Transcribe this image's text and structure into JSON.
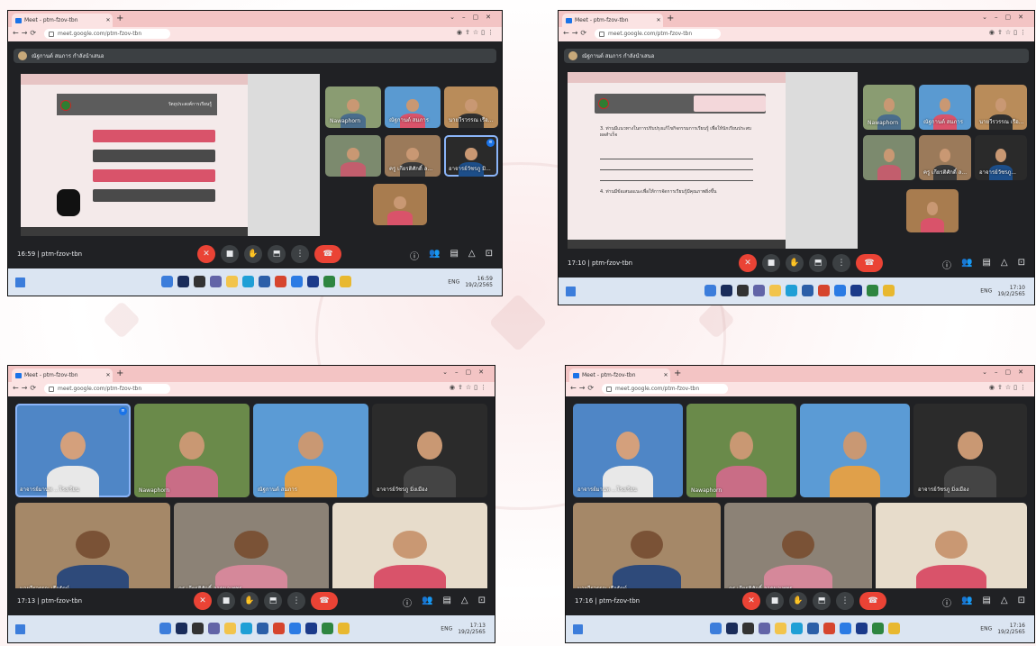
{
  "screenshots": [
    {
      "browser": {
        "tab_title": "Meet - ptm-fzov-tbn",
        "address": "meet.google.com/ptm-fzov-tbn"
      },
      "meeting": {
        "time": "16:59",
        "code": "ptm-fzov-tbn",
        "separator": "|"
      },
      "banner": "ณัฐกานต์ สมภาร กำลังนำเสนอ",
      "presentation": {
        "title": "วัตถุประสงค์การเรียนรู้"
      },
      "participants": [
        "Nawaphorn",
        "ณัฐกานต์ สมภาร",
        "นายวีรวรรณ เรือ...",
        "",
        "ครู เกียรติศักดิ์ ล...",
        "อาจารย์วัชรภู มิ..."
      ],
      "taskbar": {
        "time": "16:59",
        "date": "19/2/2565",
        "lang": "ENG"
      }
    },
    {
      "browser": {
        "tab_title": "Meet - ptm-fzov-tbn",
        "address": "meet.google.com/ptm-fzov-tbn"
      },
      "meeting": {
        "time": "17:10",
        "code": "ptm-fzov-tbn",
        "separator": "|"
      },
      "banner": "ณัฐกานต์ สมภาร กำลังนำเสนอ",
      "presentation": {
        "text1": "3. ท่านมีแนวทางในการปรับปรุงแก้ไขกิจกรรมการเรียนรู้ เพื่อให้นักเรียนประสบผลสำเร็จ",
        "text2": "4. ท่านมีข้อเสนอแนะเพื่อให้การจัดการเรียนรู้มีคุณภาพยิ่งขึ้น"
      },
      "participants": [
        "Nawaphorn",
        "ณัฐกานต์ สมภาร",
        "นายวีรวรรณ เรือ...",
        "",
        "ครู เกียรติศักดิ์ ล...",
        "อาจารย์วัชรภู..."
      ],
      "taskbar": {
        "time": "17:10",
        "date": "19/2/2565",
        "lang": "ENG"
      }
    },
    {
      "browser": {
        "tab_title": "Meet - ptm-fzov-tbn",
        "address": "meet.google.com/ptm-fzov-tbn"
      },
      "meeting": {
        "time": "17:13",
        "code": "ptm-fzov-tbn",
        "separator": "|"
      },
      "participants": [
        "อาจารย์มานพ ...โรงเรียน",
        "Nawaphorn",
        "ณัฐกานต์ สมภาร",
        "อาจารย์วัชรภู มิ่งเมือง",
        "นายวีรวรรณ เรือรัตน์",
        "ครู เกียรติศักดิ์ ลาดนาเพชร",
        ""
      ],
      "taskbar": {
        "time": "17:13",
        "date": "19/2/2565",
        "lang": "ENG"
      }
    },
    {
      "browser": {
        "tab_title": "Meet - ptm-fzov-tbn",
        "address": "meet.google.com/ptm-fzov-tbn"
      },
      "meeting": {
        "time": "17:16",
        "code": "ptm-fzov-tbn",
        "separator": "|"
      },
      "participants": [
        "อาจารย์มานพ ...โรงเรียน",
        "Nawaphorn",
        "",
        "อาจารย์วัชรภู มิ่งเมือง",
        "นายวีรวรรณ เรือรัตน์",
        "ครู เกียรติศักดิ์ ลาดนาเพชร",
        ""
      ],
      "taskbar": {
        "time": "17:16",
        "date": "19/2/2565",
        "lang": "ENG"
      }
    }
  ],
  "icons": {
    "controls": [
      "mic-off-icon",
      "camera-icon",
      "hand-icon",
      "present-icon",
      "more-icon",
      "hangup-icon"
    ],
    "right": [
      "info-icon",
      "people-icon",
      "chat-icon",
      "activities-icon",
      "lock-icon"
    ]
  },
  "colors": {
    "meet_bg": "#202124",
    "hangup": "#ea4335",
    "tab_pink": "#f3c4c4",
    "taskbar": "#dbe5f2"
  }
}
